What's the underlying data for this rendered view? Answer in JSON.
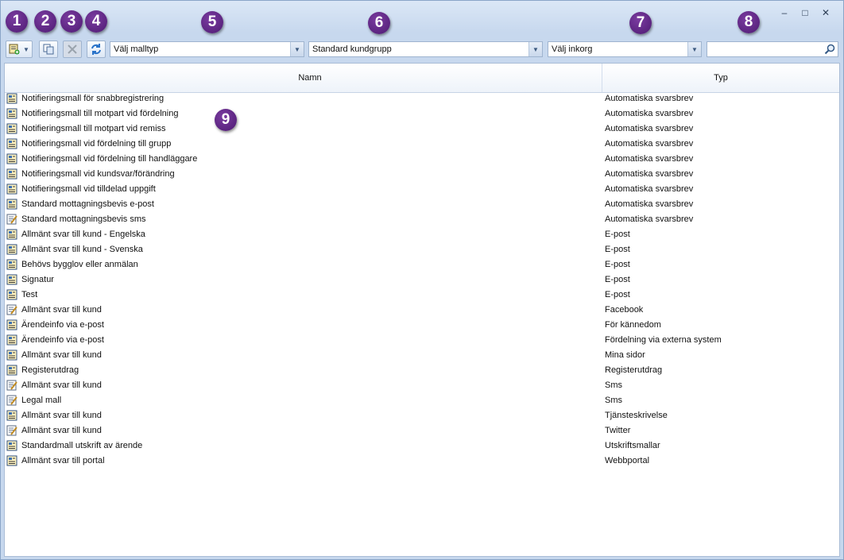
{
  "toolbar": {
    "mall_typ": "Välj malltyp",
    "kundgrupp": "Standard kundgrupp",
    "inkorg": "Välj inkorg",
    "search_value": ""
  },
  "grid": {
    "columns": [
      "Namn",
      "Typ"
    ],
    "rows": [
      {
        "name": "Notifieringsmall för snabbregistrering",
        "type": "Automatiska svarsbrev",
        "icon": "template-icon"
      },
      {
        "name": "Notifieringsmall till motpart vid fördelning",
        "type": "Automatiska svarsbrev",
        "icon": "template-icon"
      },
      {
        "name": "Notifieringsmall till motpart vid remiss",
        "type": "Automatiska svarsbrev",
        "icon": "template-icon"
      },
      {
        "name": "Notifieringsmall vid fördelning till grupp",
        "type": "Automatiska svarsbrev",
        "icon": "template-icon"
      },
      {
        "name": "Notifieringsmall vid fördelning till handläggare",
        "type": "Automatiska svarsbrev",
        "icon": "template-icon"
      },
      {
        "name": "Notifieringsmall vid kundsvar/förändring",
        "type": "Automatiska svarsbrev",
        "icon": "template-icon"
      },
      {
        "name": "Notifieringsmall vid tilldelad uppgift",
        "type": "Automatiska svarsbrev",
        "icon": "template-icon"
      },
      {
        "name": "Standard mottagningsbevis e-post",
        "type": "Automatiska svarsbrev",
        "icon": "template-icon"
      },
      {
        "name": "Standard mottagningsbevis sms",
        "type": "Automatiska svarsbrev",
        "icon": "note-icon"
      },
      {
        "name": "Allmänt svar till kund - Engelska",
        "type": "E-post",
        "icon": "template-icon"
      },
      {
        "name": "Allmänt svar till kund - Svenska",
        "type": "E-post",
        "icon": "template-icon"
      },
      {
        "name": "Behövs bygglov eller anmälan",
        "type": "E-post",
        "icon": "template-icon"
      },
      {
        "name": "Signatur",
        "type": "E-post",
        "icon": "template-icon"
      },
      {
        "name": "Test",
        "type": "E-post",
        "icon": "template-icon"
      },
      {
        "name": "Allmänt svar till kund",
        "type": "Facebook",
        "icon": "note-icon"
      },
      {
        "name": "Ärendeinfo via e-post",
        "type": "För kännedom",
        "icon": "template-icon"
      },
      {
        "name": "Ärendeinfo via e-post",
        "type": "Fördelning via externa system",
        "icon": "template-icon"
      },
      {
        "name": "Allmänt svar till kund",
        "type": "Mina sidor",
        "icon": "template-icon"
      },
      {
        "name": "Registerutdrag",
        "type": "Registerutdrag",
        "icon": "template-icon"
      },
      {
        "name": "Allmänt svar till kund",
        "type": "Sms",
        "icon": "note-icon"
      },
      {
        "name": "Legal mall",
        "type": "Sms",
        "icon": "note-icon"
      },
      {
        "name": "Allmänt svar till kund",
        "type": "Tjänsteskrivelse",
        "icon": "template-icon"
      },
      {
        "name": "Allmänt svar till kund",
        "type": "Twitter",
        "icon": "note-icon"
      },
      {
        "name": "Standardmall utskrift av ärende",
        "type": "Utskriftsmallar",
        "icon": "template-icon"
      },
      {
        "name": "Allmänt svar till portal",
        "type": "Webbportal",
        "icon": "template-icon"
      }
    ]
  },
  "callouts": [
    "1",
    "2",
    "3",
    "4",
    "5",
    "6",
    "7",
    "8",
    "9"
  ]
}
